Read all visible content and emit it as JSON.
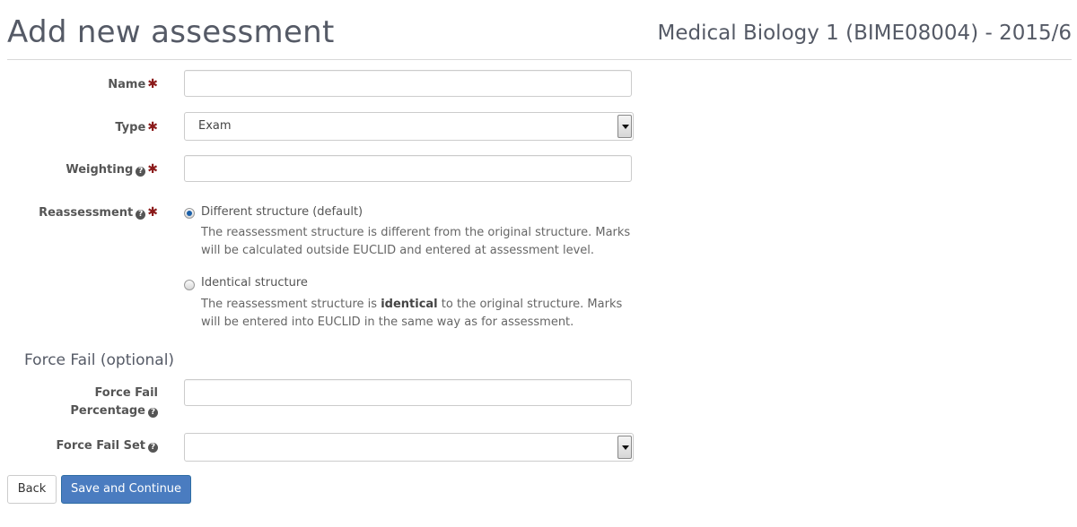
{
  "header": {
    "title": "Add new assessment",
    "course": "Medical Biology 1 (BIME08004) - 2015/6"
  },
  "form": {
    "name": {
      "label": "Name",
      "required_mark": "✱",
      "value": ""
    },
    "type": {
      "label": "Type",
      "required_mark": "✱",
      "selected": "Exam"
    },
    "weighting": {
      "label": "Weighting",
      "help_icon": "?",
      "required_mark": "✱",
      "value": ""
    },
    "reassessment": {
      "label": "Reassessment",
      "help_icon": "?",
      "required_mark": "✱",
      "options": [
        {
          "label": "Different structure (default)",
          "checked": true,
          "desc_line1": "The reassessment structure is different from the original structure. Marks",
          "desc_line2": "will be calculated outside EUCLID and entered at assessment level."
        },
        {
          "label": "Identical structure",
          "checked": false,
          "desc_pre": "The reassessment structure is ",
          "desc_bold": "identical",
          "desc_post": " to the original structure. Marks",
          "desc_line2": "will be entered into EUCLID in the same way as for assessment."
        }
      ]
    }
  },
  "force_fail": {
    "section_title": "Force Fail (optional)",
    "percentage": {
      "label_line1": "Force Fail",
      "label_line2": "Percentage",
      "help_icon": "?",
      "value": ""
    },
    "set": {
      "label": "Force Fail Set",
      "help_icon": "?",
      "selected": ""
    }
  },
  "buttons": {
    "back": "Back",
    "save": "Save and Continue"
  },
  "colors": {
    "required": "#8b1a1a",
    "primary_button": "#4a7cc0",
    "radio_checked": "#1a5fa8"
  }
}
